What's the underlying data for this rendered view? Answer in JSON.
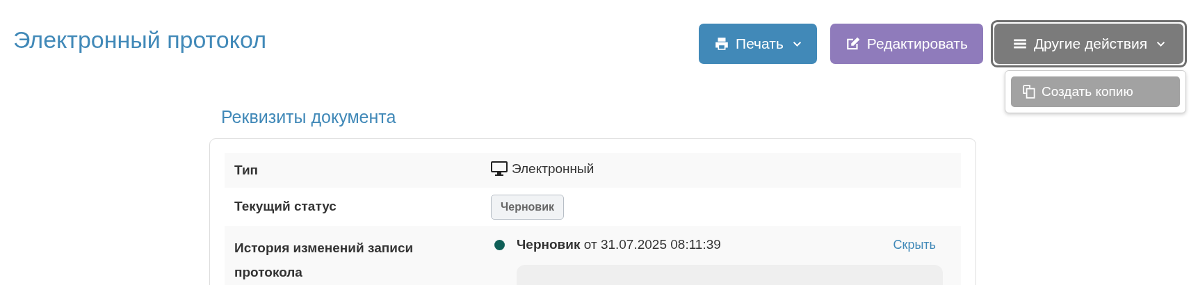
{
  "page_title": "Электронный протокол",
  "actions": [
    {
      "kind": "print",
      "label": "Печать",
      "caret": true,
      "expanded": false
    },
    {
      "kind": "edit",
      "label": "Редактировать",
      "caret": false,
      "expanded": false
    },
    {
      "kind": "more",
      "label": "Другие действия",
      "caret": true,
      "expanded": true
    }
  ],
  "dropdown": {
    "items": [
      {
        "kind": "copy",
        "label": "Создать копию"
      }
    ]
  },
  "section_title": "Реквизиты документа",
  "rows": [
    {
      "kind": "icon-text",
      "label": "Тип",
      "value": "Электронный"
    },
    {
      "kind": "badge",
      "label": "Текущий статус",
      "value": "Черновик"
    },
    {
      "kind": "history",
      "label": "История изменений записи протокола",
      "entry": "**Черновик** от 31.07.2025 08:11:39",
      "color": "#0f5f57",
      "link": "Скрыть"
    }
  ]
}
